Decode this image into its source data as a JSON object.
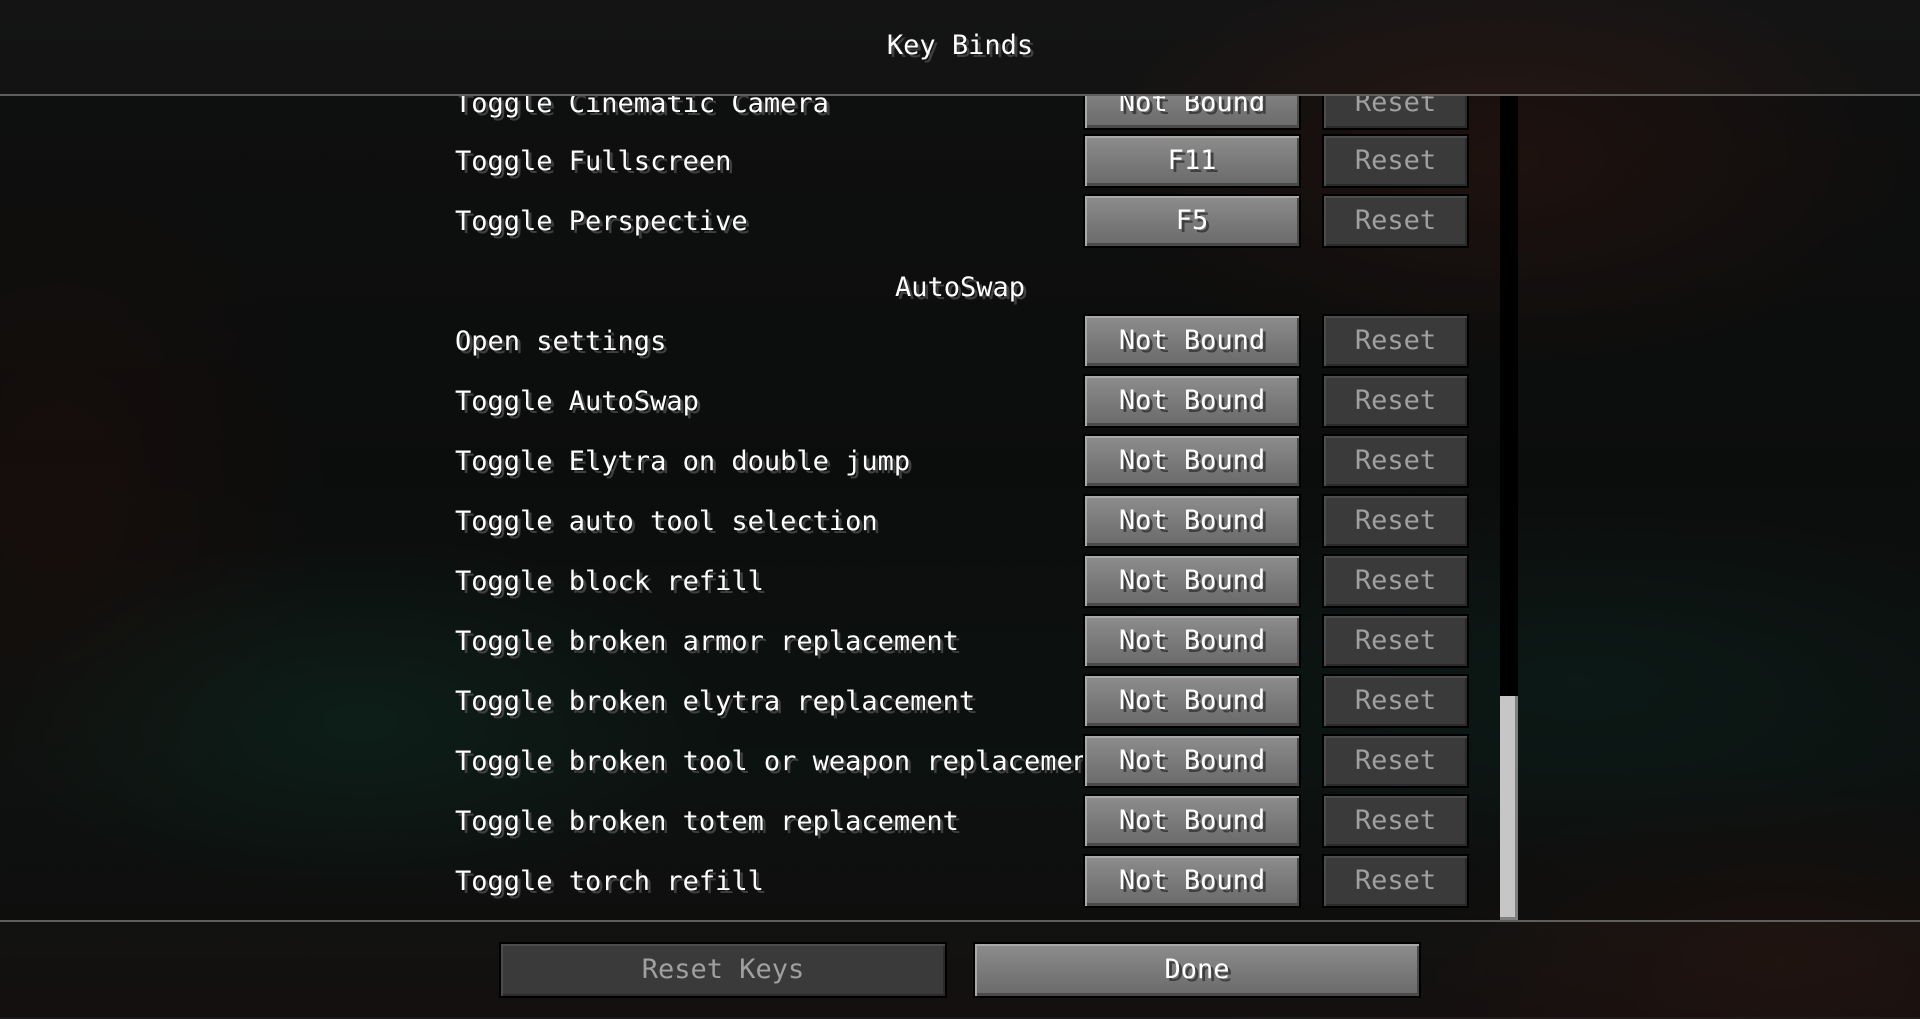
{
  "screen": {
    "title": "Key Binds"
  },
  "rows": [
    {
      "label": "Toggle Cinematic Camera",
      "key": "Not Bound",
      "reset": "Reset"
    },
    {
      "label": "Toggle Fullscreen",
      "key": "F11",
      "reset": "Reset"
    },
    {
      "label": "Toggle Perspective",
      "key": "F5",
      "reset": "Reset"
    }
  ],
  "category": "AutoSwap",
  "autoswap_rows": [
    {
      "label": "Open settings",
      "key": "Not Bound",
      "reset": "Reset"
    },
    {
      "label": "Toggle AutoSwap",
      "key": "Not Bound",
      "reset": "Reset"
    },
    {
      "label": "Toggle Elytra on double jump",
      "key": "Not Bound",
      "reset": "Reset"
    },
    {
      "label": "Toggle auto tool selection",
      "key": "Not Bound",
      "reset": "Reset"
    },
    {
      "label": "Toggle block refill",
      "key": "Not Bound",
      "reset": "Reset"
    },
    {
      "label": "Toggle broken armor replacement",
      "key": "Not Bound",
      "reset": "Reset"
    },
    {
      "label": "Toggle broken elytra replacement",
      "key": "Not Bound",
      "reset": "Reset"
    },
    {
      "label": "Toggle broken tool or weapon replacement",
      "key": "Not Bound",
      "reset": "Reset"
    },
    {
      "label": "Toggle broken totem replacement",
      "key": "Not Bound",
      "reset": "Reset"
    },
    {
      "label": "Toggle torch refill",
      "key": "Not Bound",
      "reset": "Reset"
    }
  ],
  "footer": {
    "reset_keys": "Reset Keys",
    "done": "Done"
  }
}
